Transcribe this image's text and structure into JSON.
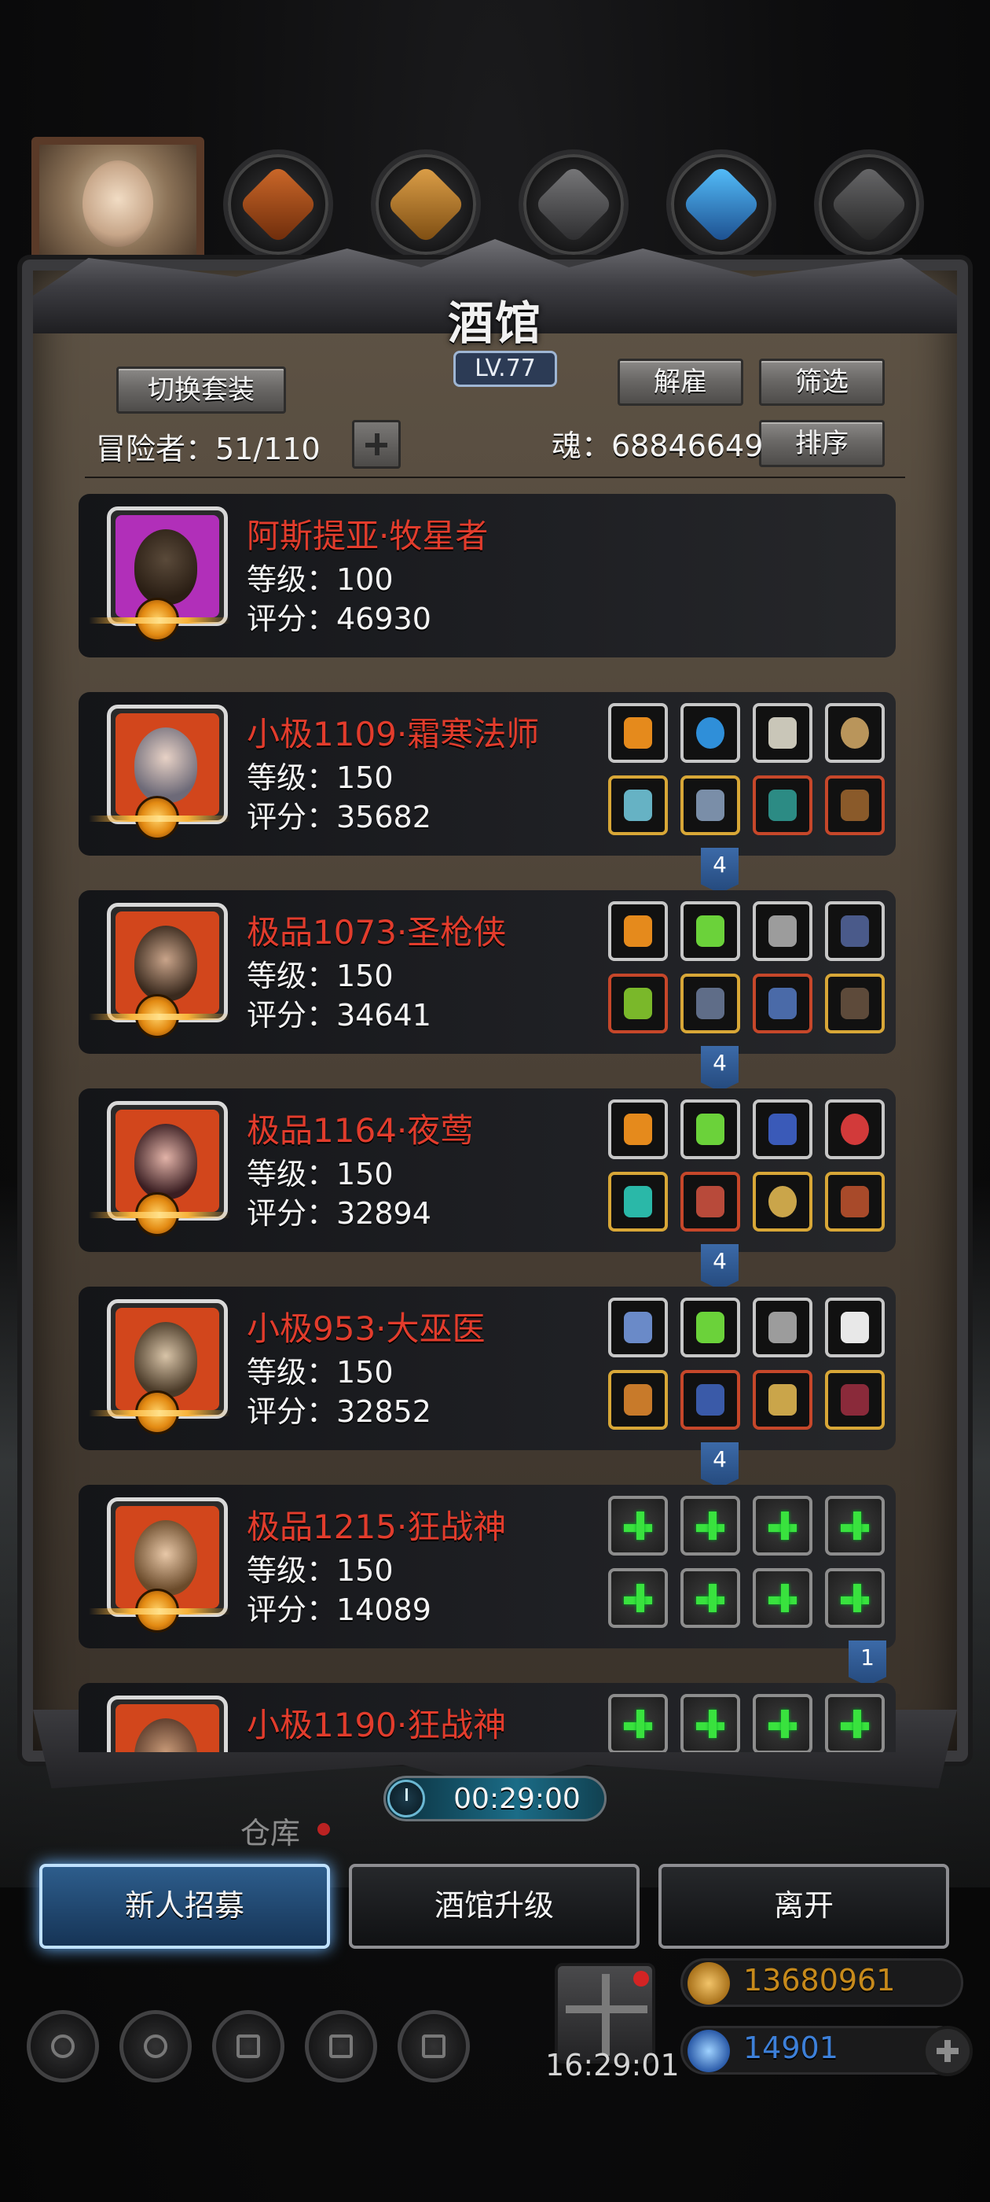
{
  "panel": {
    "title": "酒馆",
    "level": "LV.77",
    "switch_outfit_label": "切换套装",
    "dismiss_label": "解雇",
    "filter_label": "筛选",
    "sort_label": "排序",
    "adventurers_text": "冒险者：51/110",
    "soul_text": "魂：68846649"
  },
  "heroes": [
    {
      "name": "阿斯提亚·牧星者",
      "level": "等级：100",
      "score": "评分：46930",
      "frame": "purple",
      "tag": ""
    },
    {
      "name": "小极1109·霜寒法师",
      "level": "等级：150",
      "score": "评分：35682",
      "frame": "orange",
      "tag": "4"
    },
    {
      "name": "极品1073·圣枪侠",
      "level": "等级：150",
      "score": "评分：34641",
      "frame": "orange",
      "tag": "4"
    },
    {
      "name": "极品1164·夜莺",
      "level": "等级：150",
      "score": "评分：32894",
      "frame": "orange",
      "tag": "4"
    },
    {
      "name": "小极953·大巫医",
      "level": "等级：150",
      "score": "评分：32852",
      "frame": "orange",
      "tag": "4"
    },
    {
      "name": "极品1215·狂战神",
      "level": "等级：150",
      "score": "评分：14089",
      "frame": "orange",
      "tag": "1"
    },
    {
      "name": "小极1190·狂战神",
      "level": "",
      "score": "",
      "frame": "orange",
      "tag": ""
    }
  ],
  "timer": "00:29:00",
  "warehouse_label": "仓库",
  "actions": {
    "recruit_label": "新人招募",
    "upgrade_label": "酒馆升级",
    "leave_label": "离开"
  },
  "hud": {
    "gift_timer": "16:29:01",
    "gold_amount": "13680961",
    "gem_amount": "14901"
  },
  "colors": {
    "hero_name": "#e23c2c",
    "gold_text": "#c78a1b",
    "gem_text": "#3d80d9",
    "empty_slot_plus": "#39e23e"
  }
}
